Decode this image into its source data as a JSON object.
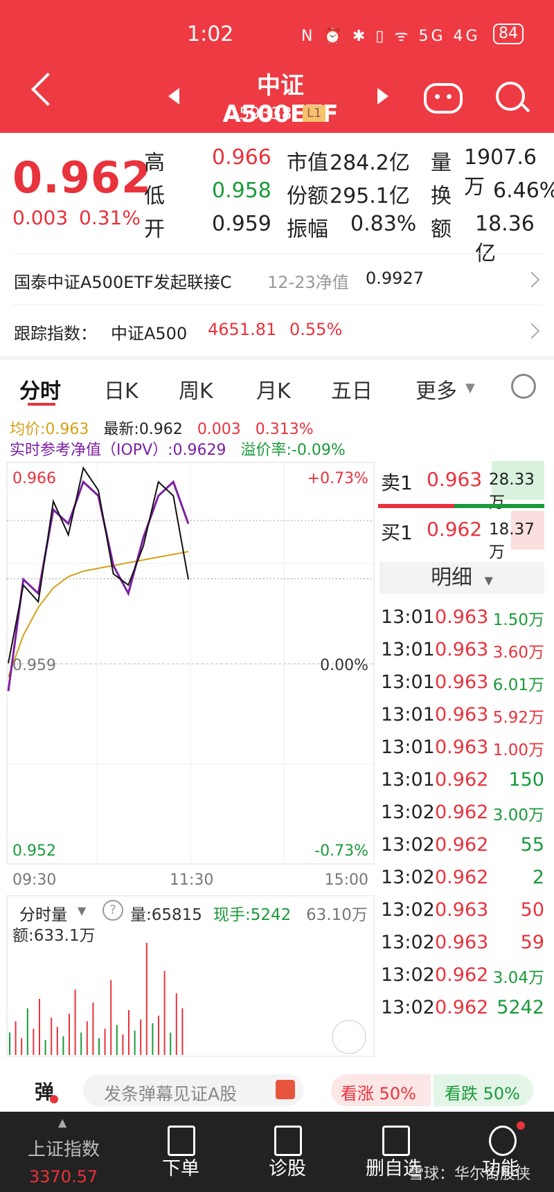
{
  "status": {
    "time": "1:02",
    "icons": "N ⏰ ✱ ▯ ᯤ 5G 4G",
    "battery": "84"
  },
  "header": {
    "title": "中证A500ETF",
    "code": "159338",
    "level": "L1"
  },
  "quote": {
    "price": "0.962",
    "change": "0.003",
    "change_pct": "0.31%",
    "high_label": "高",
    "high": "0.966",
    "low_label": "低",
    "low": "0.958",
    "open_label": "开",
    "open": "0.959",
    "mcap_label": "市值",
    "mcap": "284.2亿",
    "shares_label": "份额",
    "shares": "295.1亿",
    "amp_label": "振幅",
    "amp": "0.83%",
    "vol_label": "量",
    "vol": "1907.6万",
    "turn_label": "换",
    "turn": "6.46%",
    "amt_label": "额",
    "amt": "18.36亿"
  },
  "feeder": {
    "name": "国泰中证A500ETF发起联接C",
    "date_label": "12-23净值",
    "nav": "0.9927"
  },
  "tracking": {
    "label": "跟踪指数：",
    "index": "中证A500",
    "value": "4651.81",
    "pct": "0.55%"
  },
  "tabs": [
    "分时",
    "日K",
    "周K",
    "月K",
    "五日",
    "更多"
  ],
  "legend": {
    "avg": "均价:0.963",
    "latest": "最新:0.962",
    "chg": "0.003",
    "pct": "0.313%",
    "iopv": "实时参考净值（IOPV）:0.9629",
    "premium": "溢价率:-0.09%"
  },
  "chart_data": {
    "type": "line",
    "x_labels": [
      "09:30",
      "11:30",
      "15:00"
    ],
    "y_labels": {
      "top": "0.966",
      "mid": "0.959",
      "bottom": "0.952"
    },
    "pct_labels": {
      "top": "+0.73%",
      "mid": "0.00%",
      "bottom": "-0.73%"
    },
    "ylim": [
      0.952,
      0.966
    ],
    "series": [
      {
        "name": "均价",
        "color": "#d4a017",
        "values": [
          0.9585,
          0.96,
          0.961,
          0.9617,
          0.9621,
          0.9623,
          0.9624,
          0.9625,
          0.9626,
          0.9627,
          0.9628,
          0.9629,
          0.963
        ]
      },
      {
        "name": "实时参考净值（IOPV）",
        "color": "#7b1fa2",
        "values": [
          0.958,
          0.962,
          0.9615,
          0.9645,
          0.964,
          0.9655,
          0.965,
          0.9625,
          0.9615,
          0.9635,
          0.965,
          0.9655,
          0.964
        ]
      },
      {
        "name": "最新",
        "color": "#111111",
        "values": [
          0.959,
          0.9618,
          0.9612,
          0.9648,
          0.9636,
          0.966,
          0.9652,
          0.9622,
          0.9618,
          0.9632,
          0.9655,
          0.965,
          0.962
        ]
      }
    ],
    "volume": [
      12,
      18,
      9,
      25,
      14,
      30,
      8,
      20,
      15,
      10,
      22,
      35,
      12,
      18,
      28,
      9,
      14,
      40,
      16,
      11,
      24,
      13,
      19,
      60,
      17,
      21,
      45,
      12,
      33,
      25
    ]
  },
  "orderbook": {
    "sell_label": "卖1",
    "sell_price": "0.963",
    "sell_vol": "28.33万",
    "buy_label": "买1",
    "buy_price": "0.962",
    "buy_vol": "18.37万",
    "detail_label": "明细"
  },
  "ticks": [
    {
      "t": "13:01",
      "p": "0.963",
      "v": "1.50万",
      "c": "green"
    },
    {
      "t": "13:01",
      "p": "0.963",
      "v": "3.60万",
      "c": "red"
    },
    {
      "t": "13:01",
      "p": "0.963",
      "v": "6.01万",
      "c": "green"
    },
    {
      "t": "13:01",
      "p": "0.963",
      "v": "5.92万",
      "c": "red"
    },
    {
      "t": "13:01",
      "p": "0.963",
      "v": "1.00万",
      "c": "red"
    },
    {
      "t": "13:01",
      "p": "0.962",
      "v": "150",
      "c": "green"
    },
    {
      "t": "13:02",
      "p": "0.962",
      "v": "3.00万",
      "c": "green"
    },
    {
      "t": "13:02",
      "p": "0.962",
      "v": "55",
      "c": "green"
    },
    {
      "t": "13:02",
      "p": "0.962",
      "v": "2",
      "c": "green"
    },
    {
      "t": "13:02",
      "p": "0.963",
      "v": "50",
      "c": "red"
    },
    {
      "t": "13:02",
      "p": "0.963",
      "v": "59",
      "c": "red"
    },
    {
      "t": "13:02",
      "p": "0.962",
      "v": "3.04万",
      "c": "green"
    },
    {
      "t": "13:02",
      "p": "0.962",
      "v": "5242",
      "c": "green"
    }
  ],
  "volpanel": {
    "label": "分时量",
    "vol": "量:65815",
    "hand": "现手:5242",
    "max": "63.10万",
    "amt": "额:633.1万"
  },
  "barrage": {
    "btn": "弹",
    "placeholder": "发条弹幕见证A股",
    "up": "看涨 50%",
    "down": "看跌 50%"
  },
  "nav": {
    "index_name": "上证指数",
    "index_value": "3370.57",
    "items": [
      "下单",
      "诊股",
      "删自选",
      "功能"
    ],
    "watermark": "雪球：华尔街股侠"
  }
}
